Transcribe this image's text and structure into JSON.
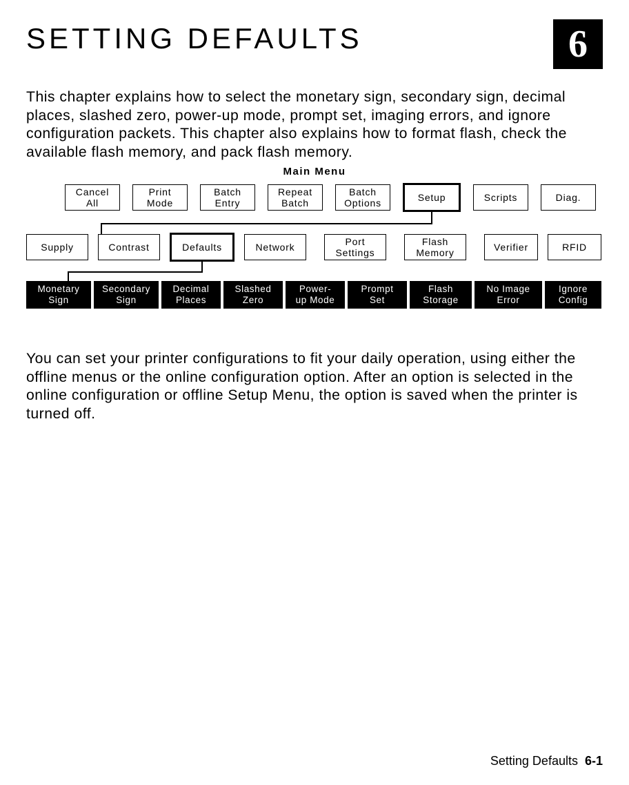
{
  "chapter_number": "6",
  "title": "SETTING DEFAULTS",
  "intro": "This chapter explains how to select the monetary sign, secondary sign, decimal places, slashed zero, power-up mode, prompt set, imaging errors, and ignore configuration packets.  This chapter also explains how to format flash, check the available flash memory, and pack flash memory.",
  "menu_title": "Main Menu",
  "row1": {
    "cancel_all": "Cancel\nAll",
    "print_mode": "Print\nMode",
    "batch_entry": "Batch\nEntry",
    "repeat_batch": "Repeat\nBatch",
    "batch_options": "Batch\nOptions",
    "setup": "Setup",
    "scripts": "Scripts",
    "diag": "Diag."
  },
  "row2": {
    "supply": "Supply",
    "contrast": "Contrast",
    "defaults": "Defaults",
    "network": "Network",
    "port_settings": "Port\nSettings",
    "flash_memory": "Flash\nMemory",
    "verifier": "Verifier",
    "rfid": "RFID"
  },
  "row3": {
    "monetary_sign": "Monetary\nSign",
    "secondary_sign": "Secondary\nSign",
    "decimal_places": "Decimal\nPlaces",
    "slashed_zero": "Slashed\nZero",
    "power_up_mode": "Power-\nup Mode",
    "prompt_set": "Prompt\nSet",
    "flash_storage": "Flash\nStorage",
    "no_image_error": "No Image\nError",
    "ignore_config": "Ignore\nConfig"
  },
  "para2": "You can set your printer configurations to fit your daily operation, using either the offline menus or the online configuration option.  After an option is selected in the online configuration or offline Setup Menu, the option is saved when the printer is turned off.",
  "footer_label": "Setting Defaults",
  "footer_page": "6-1"
}
